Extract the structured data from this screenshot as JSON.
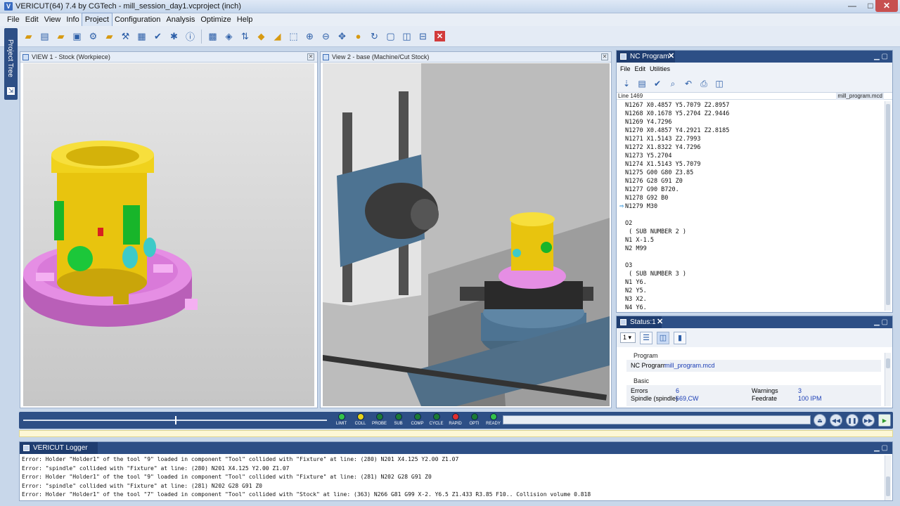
{
  "window": {
    "title": "VERICUT(64)  7.4 by CGTech - mill_session_day1.vcproject (inch)",
    "min_glyph": "—",
    "max_glyph": "□",
    "close_glyph": "✕",
    "app_icon": "V"
  },
  "menubar": [
    "File",
    "Edit",
    "View",
    "Info",
    "Project",
    "Configuration",
    "Analysis",
    "Optimize",
    "Help"
  ],
  "project_tree_tab": "Project Tree",
  "view1": {
    "title": "VIEW 1 - Stock (Workpiece)"
  },
  "view2": {
    "title": "View 2 - base (Machine/Cut Stock)"
  },
  "nc_program": {
    "tab": "NC Program",
    "menu": [
      "File",
      "Edit",
      "Utilities"
    ],
    "line_indicator": "Line 1469",
    "file_name": "mill_program.mcd",
    "lines": [
      "N1267 X0.4857 Y5.7079 Z2.8957",
      "N1268 X0.1678 Y5.2704 Z2.9446",
      "N1269 Y4.7296",
      "N1270 X0.4857 Y4.2921 Z2.8185",
      "N1271 X1.5143 Z2.7993",
      "N1272 X1.8322 Y4.7296",
      "N1273 Y5.2704",
      "N1274 X1.5143 Y5.7079",
      "N1275 G00 G80 Z3.85",
      "N1276 G28 G91 Z0",
      "N1277 G90 B720.",
      "N1278 G92 B0",
      "N1279 M30",
      "",
      "O2",
      " ( SUB NUMBER 2 )",
      "N1 X-1.5",
      "N2 M99",
      "",
      "O3",
      " ( SUB NUMBER 3 )",
      "N1 Y6.",
      "N2 Y5.",
      "N3 X2.",
      "N4 Y6."
    ],
    "current_line_index": 12
  },
  "status": {
    "tab": "Status:1",
    "selector": "1 ▾",
    "program_header": "Program",
    "program_label": "NC Program",
    "program_value": "mill_program.mcd",
    "basic_header": "Basic",
    "errors_label": "Errors",
    "errors_value": "6",
    "warnings_label": "Warnings",
    "warnings_value": "3",
    "spindle_label": "Spindle (spindle)",
    "spindle_value": "669,CW",
    "feedrate_label": "Feedrate",
    "feedrate_value": "100 IPM"
  },
  "animation": {
    "lights": [
      {
        "label": "LIMIT",
        "color": "#33c24a"
      },
      {
        "label": "COLL",
        "color": "#e6d21a"
      },
      {
        "label": "PROBE",
        "color": "#1c7a35"
      },
      {
        "label": "SUB",
        "color": "#1c7a35"
      },
      {
        "label": "COMP",
        "color": "#1c7a35"
      },
      {
        "label": "CYCLE",
        "color": "#1c7a35"
      },
      {
        "label": "RAPID",
        "color": "#e03030"
      },
      {
        "label": "OPTI",
        "color": "#1c7a35"
      },
      {
        "label": "READY",
        "color": "#33c24a"
      }
    ],
    "slider_position": 0.5
  },
  "logger": {
    "tab": "VERICUT Logger",
    "lines": [
      "Error: Holder \"Holder1\" of the tool \"9\" loaded in component \"Tool\" collided with \"Fixture\" at line: (280) N201 X4.125 Y2.00 Z1.07",
      "Error: \"spindle\" collided with \"Fixture\" at line: (280) N201 X4.125 Y2.00 Z1.07",
      "Error: Holder \"Holder1\" of the tool \"9\" loaded in component \"Tool\" collided with \"Fixture\" at line: (281) N202 G28 G91 Z0",
      "Error: \"spindle\" collided with \"Fixture\" at line: (281) N202 G28 G91 Z0",
      "Error: Holder \"Holder1\" of the tool \"7\" loaded in component \"Tool\" collided with \"Stock\" at line: (363) N266 G81 G99 X-2. Y6.5 Z1.433 R3.85 F10.. Collision volume 0.818"
    ]
  },
  "colors": {
    "panel_tab": "#2d4f86",
    "stock_yellow": "#f2d21a",
    "fixture_pink": "#d877d8",
    "machine_steel": "#4d7392"
  }
}
